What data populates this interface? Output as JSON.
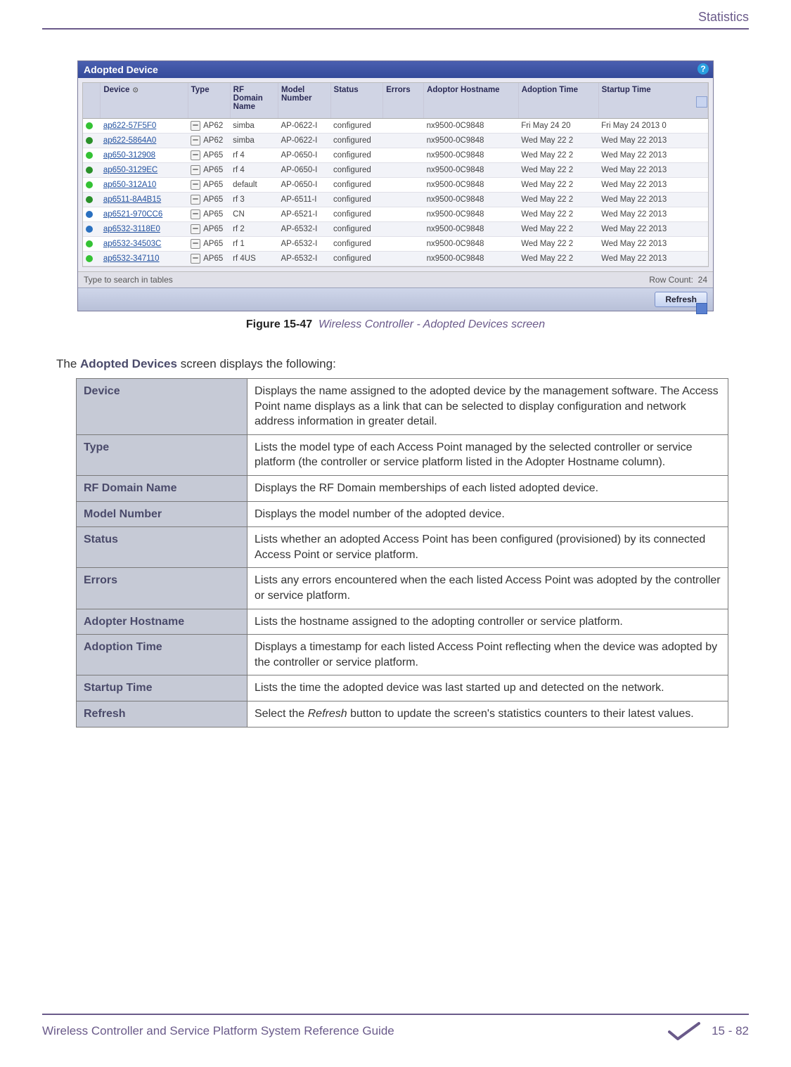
{
  "header": {
    "section": "Statistics"
  },
  "figure": {
    "panel_title": "Adopted Device",
    "help_symbol": "?",
    "columns": [
      "Device",
      "Type",
      "RF Domain Name",
      "Model Number",
      "Status",
      "Errors",
      "Adoptor Hostname",
      "Adoption Time",
      "Startup Time"
    ],
    "sort_col_index": 0,
    "rows": [
      {
        "dot": "g1",
        "device": "ap622-57F5F0",
        "type": "AP62",
        "rf": "simba",
        "model": "AP-0622-I",
        "status": "configured",
        "errors": "",
        "host": "nx9500-0C9848",
        "adopt": "Fri May 24 20",
        "start": "Fri May 24 2013 0"
      },
      {
        "dot": "g2",
        "device": "ap622-5864A0",
        "type": "AP62",
        "rf": "simba",
        "model": "AP-0622-I",
        "status": "configured",
        "errors": "",
        "host": "nx9500-0C9848",
        "adopt": "Wed May 22 2",
        "start": "Wed May 22 2013"
      },
      {
        "dot": "g1",
        "device": "ap650-312908",
        "type": "AP65",
        "rf": "rf 4",
        "model": "AP-0650-I",
        "status": "configured",
        "errors": "",
        "host": "nx9500-0C9848",
        "adopt": "Wed May 22 2",
        "start": "Wed May 22 2013"
      },
      {
        "dot": "g2",
        "device": "ap650-3129EC",
        "type": "AP65",
        "rf": "rf 4",
        "model": "AP-0650-I",
        "status": "configured",
        "errors": "",
        "host": "nx9500-0C9848",
        "adopt": "Wed May 22 2",
        "start": "Wed May 22 2013"
      },
      {
        "dot": "g1",
        "device": "ap650-312A10",
        "type": "AP65",
        "rf": "default",
        "model": "AP-0650-I",
        "status": "configured",
        "errors": "",
        "host": "nx9500-0C9848",
        "adopt": "Wed May 22 2",
        "start": "Wed May 22 2013"
      },
      {
        "dot": "g2",
        "device": "ap6511-8A4B15",
        "type": "AP65",
        "rf": "rf 3",
        "model": "AP-6511-I",
        "status": "configured",
        "errors": "",
        "host": "nx9500-0C9848",
        "adopt": "Wed May 22 2",
        "start": "Wed May 22 2013"
      },
      {
        "dot": "b1",
        "device": "ap6521-970CC6",
        "type": "AP65",
        "rf": "CN",
        "model": "AP-6521-I",
        "status": "configured",
        "errors": "",
        "host": "nx9500-0C9848",
        "adopt": "Wed May 22 2",
        "start": "Wed May 22 2013"
      },
      {
        "dot": "b1",
        "device": "ap6532-3118E0",
        "type": "AP65",
        "rf": "rf 2",
        "model": "AP-6532-I",
        "status": "configured",
        "errors": "",
        "host": "nx9500-0C9848",
        "adopt": "Wed May 22 2",
        "start": "Wed May 22 2013"
      },
      {
        "dot": "g1",
        "device": "ap6532-34503C",
        "type": "AP65",
        "rf": "rf 1",
        "model": "AP-6532-I",
        "status": "configured",
        "errors": "",
        "host": "nx9500-0C9848",
        "adopt": "Wed May 22 2",
        "start": "Wed May 22 2013"
      },
      {
        "dot": "g1",
        "device": "ap6532-347110",
        "type": "AP65",
        "rf": "rf 4US",
        "model": "AP-6532-I",
        "status": "configured",
        "errors": "",
        "host": "nx9500-0C9848",
        "adopt": "Wed May 22 2",
        "start": "Wed May 22 2013"
      }
    ],
    "search_placeholder": "Type to search in tables",
    "row_count_label": "Row Count:",
    "row_count_value": "24",
    "refresh_label": "Refresh",
    "caption_label": "Figure 15-47",
    "caption_desc": "Wireless Controller - Adopted Devices screen"
  },
  "lead": {
    "pre": "The ",
    "em": "Adopted Devices",
    "post": " screen displays the following:"
  },
  "desc_table": [
    {
      "term": "Device",
      "defn": "Displays the name assigned to the adopted device by the management software. The Access Point name displays as a link that can be selected to display configuration and network address information in greater detail."
    },
    {
      "term": "Type",
      "defn": "Lists the model type of each Access Point managed by the selected controller or service platform (the controller or service platform listed in the Adopter Hostname column)."
    },
    {
      "term": "RF Domain Name",
      "defn": "Displays the RF Domain memberships of each listed adopted device."
    },
    {
      "term": "Model Number",
      "defn": "Displays the model number of the adopted device."
    },
    {
      "term": "Status",
      "defn": "Lists whether an adopted Access Point has been configured (provisioned) by its connected Access Point or service platform."
    },
    {
      "term": "Errors",
      "defn": "Lists any errors encountered when the each listed Access Point was adopted by the controller or service platform."
    },
    {
      "term": "Adopter Hostname",
      "defn": "Lists the hostname assigned to the adopting controller or service platform."
    },
    {
      "term": "Adoption Time",
      "defn": "Displays a timestamp for each listed Access Point reflecting when the device was adopted by the controller or service platform."
    },
    {
      "term": "Startup Time",
      "defn": "Lists the time the adopted device was last started up and detected on the network."
    },
    {
      "term": "Refresh",
      "defn_html": "Select the <em>Refresh</em> button to update the screen's statistics counters to their latest values."
    }
  ],
  "footer": {
    "guide": "Wireless Controller and Service Platform System Reference Guide",
    "page": "15 - 82"
  }
}
